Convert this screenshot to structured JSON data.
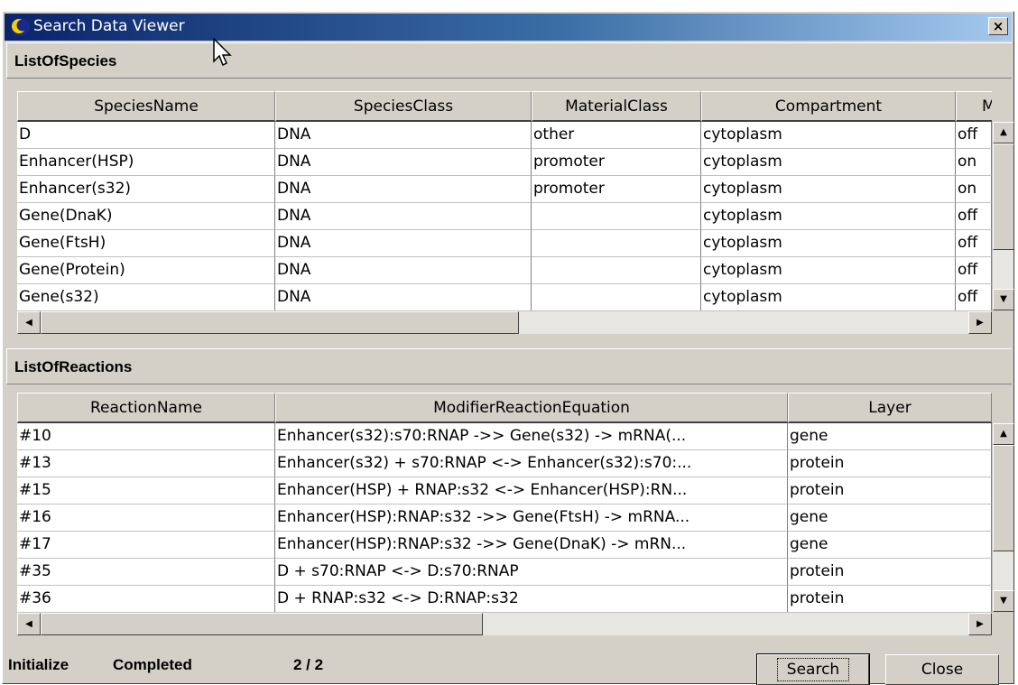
{
  "window": {
    "title": "Search Data Viewer",
    "close_glyph": "×"
  },
  "species": {
    "title": "ListOfSpecies",
    "columns": [
      "SpeciesName",
      "SpeciesClass",
      "MaterialClass",
      "Compartment",
      "M"
    ],
    "rows": [
      [
        "D",
        "DNA",
        "other",
        "cytoplasm",
        "off"
      ],
      [
        "Enhancer(HSP)",
        "DNA",
        "promoter",
        "cytoplasm",
        "on"
      ],
      [
        "Enhancer(s32)",
        "DNA",
        "promoter",
        "cytoplasm",
        "on"
      ],
      [
        "Gene(DnaK)",
        "DNA",
        "",
        "cytoplasm",
        "off"
      ],
      [
        "Gene(FtsH)",
        "DNA",
        "",
        "cytoplasm",
        "off"
      ],
      [
        "Gene(Protein)",
        "DNA",
        "",
        "cytoplasm",
        "off"
      ],
      [
        "Gene(s32)",
        "DNA",
        "",
        "cytoplasm",
        "off"
      ]
    ]
  },
  "reactions": {
    "title": "ListOfReactions",
    "columns": [
      "ReactionName",
      "ModifierReactionEquation",
      "Layer"
    ],
    "rows": [
      [
        "#10",
        "Enhancer(s32):s70:RNAP ->> Gene(s32) -> mRNA(...",
        "gene"
      ],
      [
        "#13",
        "Enhancer(s32) + s70:RNAP <-> Enhancer(s32):s70:...",
        "protein"
      ],
      [
        "#15",
        "Enhancer(HSP) + RNAP:s32 <-> Enhancer(HSP):RN...",
        "protein"
      ],
      [
        "#16",
        "Enhancer(HSP):RNAP:s32 ->> Gene(FtsH) -> mRNA...",
        "gene"
      ],
      [
        "#17",
        "Enhancer(HSP):RNAP:s32 ->> Gene(DnaK) -> mRN...",
        "gene"
      ],
      [
        "#35",
        "D + s70:RNAP <-> D:s70:RNAP",
        "protein"
      ],
      [
        "#36",
        "D + RNAP:s32 <-> D:RNAP:s32",
        "protein"
      ]
    ]
  },
  "status": {
    "label1": "Initialize",
    "label2": "Completed",
    "progress": "2 / 2"
  },
  "buttons": {
    "search": "Search",
    "close": "Close"
  },
  "scroll_glyphs": {
    "up": "▲",
    "down": "▼",
    "left": "◀",
    "right": "▶"
  },
  "colors": {
    "title_bar_start": "#0a246a",
    "title_bar_end": "#a6caf0",
    "window_face": "#d4d0c8"
  }
}
